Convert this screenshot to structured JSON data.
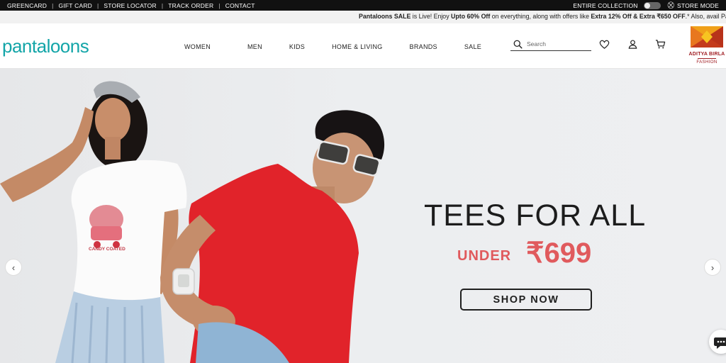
{
  "utility_bar": {
    "links": [
      "GREENCARD",
      "GIFT CARD",
      "STORE LOCATOR",
      "TRACK ORDER",
      "CONTACT"
    ],
    "entire_collection": "ENTIRE COLLECTION",
    "store_mode": "STORE MODE"
  },
  "promo": {
    "part1": "Pantaloons SALE",
    "part2": " is Live! Enjoy ",
    "part3": "Upto 60% Off",
    "part4": " on everything, along with offers like ",
    "part5": "Extra 12% Off & Extra ₹650 OFF",
    "part6": ".* Also, avail Payt"
  },
  "header": {
    "logo": "pantaloons",
    "nav": [
      "WOMEN",
      "MEN",
      "KIDS",
      "HOME & LIVING",
      "BRANDS",
      "SALE"
    ],
    "search_placeholder": "Search",
    "icons": [
      "search-icon",
      "heart-icon",
      "user-icon",
      "cart-icon"
    ],
    "partner": {
      "name": "ADITYA BIRLA",
      "sub": "FASHION"
    }
  },
  "hero": {
    "headline": "TEES FOR ALL",
    "under": "UNDER",
    "price": "₹699",
    "cta": "SHOP NOW",
    "tee_print_1": "CANDY COATED"
  },
  "colors": {
    "brand_teal": "#13a5a8",
    "price_red": "#e05a5d",
    "partner_red": "#a01e23",
    "tee_red": "#e1232a"
  }
}
